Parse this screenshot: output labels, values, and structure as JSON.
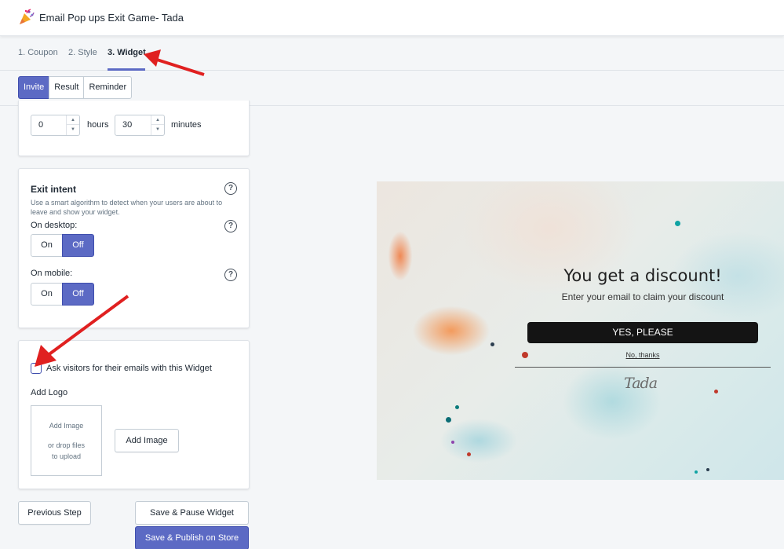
{
  "app": {
    "title": "Email Pop ups Exit Game- Tada"
  },
  "steps": [
    {
      "label": "1. Coupon"
    },
    {
      "label": "2. Style"
    },
    {
      "label": "3. Widget"
    }
  ],
  "subtabs": [
    {
      "label": "Invite"
    },
    {
      "label": "Result"
    },
    {
      "label": "Reminder"
    }
  ],
  "timer": {
    "hours_value": "0",
    "hours_label": "hours",
    "minutes_value": "30",
    "minutes_label": "minutes"
  },
  "exit_intent": {
    "title": "Exit intent",
    "description": "Use a smart algorithm to detect when your users are about to leave and show your widget.",
    "desktop_label": "On desktop:",
    "mobile_label": "On mobile:",
    "on_label": "On",
    "off_label": "Off",
    "desktop_selected": "Off",
    "mobile_selected": "Off",
    "help_symbol": "?"
  },
  "email_section": {
    "checkbox_label": "Ask visitors for their emails with this Widget",
    "checked": false,
    "add_logo_label": "Add Logo",
    "drop_zone": {
      "line1": "Add Image",
      "line2": "or drop files",
      "line3": "to upload"
    },
    "add_image_button": "Add Image"
  },
  "footer": {
    "previous_button": "Previous Step",
    "pause_button": "Save & Pause Widget",
    "publish_button": "Save & Publish on Store"
  },
  "preview": {
    "title": "You get a discount!",
    "subtitle": "Enter your email to claim your discount",
    "cta": "YES, PLEASE",
    "decline": "No, thanks",
    "logo_text": "Tada"
  },
  "colors": {
    "accent": "#5c6ac4",
    "annotation_arrow": "#e02020",
    "cta_background": "#141414"
  },
  "icons": {
    "app_logo": "party-popper-icon",
    "help": "question-circle-icon",
    "stepper_up": "caret-up-icon",
    "stepper_down": "caret-down-icon"
  }
}
